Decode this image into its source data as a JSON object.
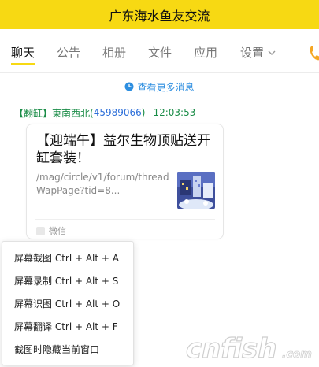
{
  "window": {
    "title": "广东海水鱼友交流"
  },
  "tabs": [
    {
      "label": "聊天"
    },
    {
      "label": "公告"
    },
    {
      "label": "相册"
    },
    {
      "label": "文件"
    },
    {
      "label": "应用"
    },
    {
      "label": "设置"
    }
  ],
  "chat": {
    "more_messages": "查看更多消息",
    "sender_tag": "【翻缸】",
    "sender_name": "東南西北(",
    "sender_qq": "45989066",
    "sender_close": ")",
    "time": "12:03:53",
    "card": {
      "title": "【迎端午】益尔生物顶贴送开缸套装！",
      "url": "/mag/circle/v1/forum/threadWapPage?tid=8...",
      "source": "微信"
    }
  },
  "context_menu": {
    "items": [
      {
        "label": "屏幕截图 Ctrl + Alt + A"
      },
      {
        "label": "屏幕录制 Ctrl + Alt + S"
      },
      {
        "label": "屏幕识图 Ctrl + Alt + O"
      },
      {
        "label": "屏幕翻译 Ctrl + Alt + F"
      },
      {
        "label": "截图时隐藏当前窗口"
      }
    ]
  },
  "watermark": {
    "text": "cnfish",
    "suffix": ".com"
  },
  "colors": {
    "title_bar": "#f7d913",
    "link_blue": "#2d8ee0",
    "sender_green": "#1a8c47"
  }
}
